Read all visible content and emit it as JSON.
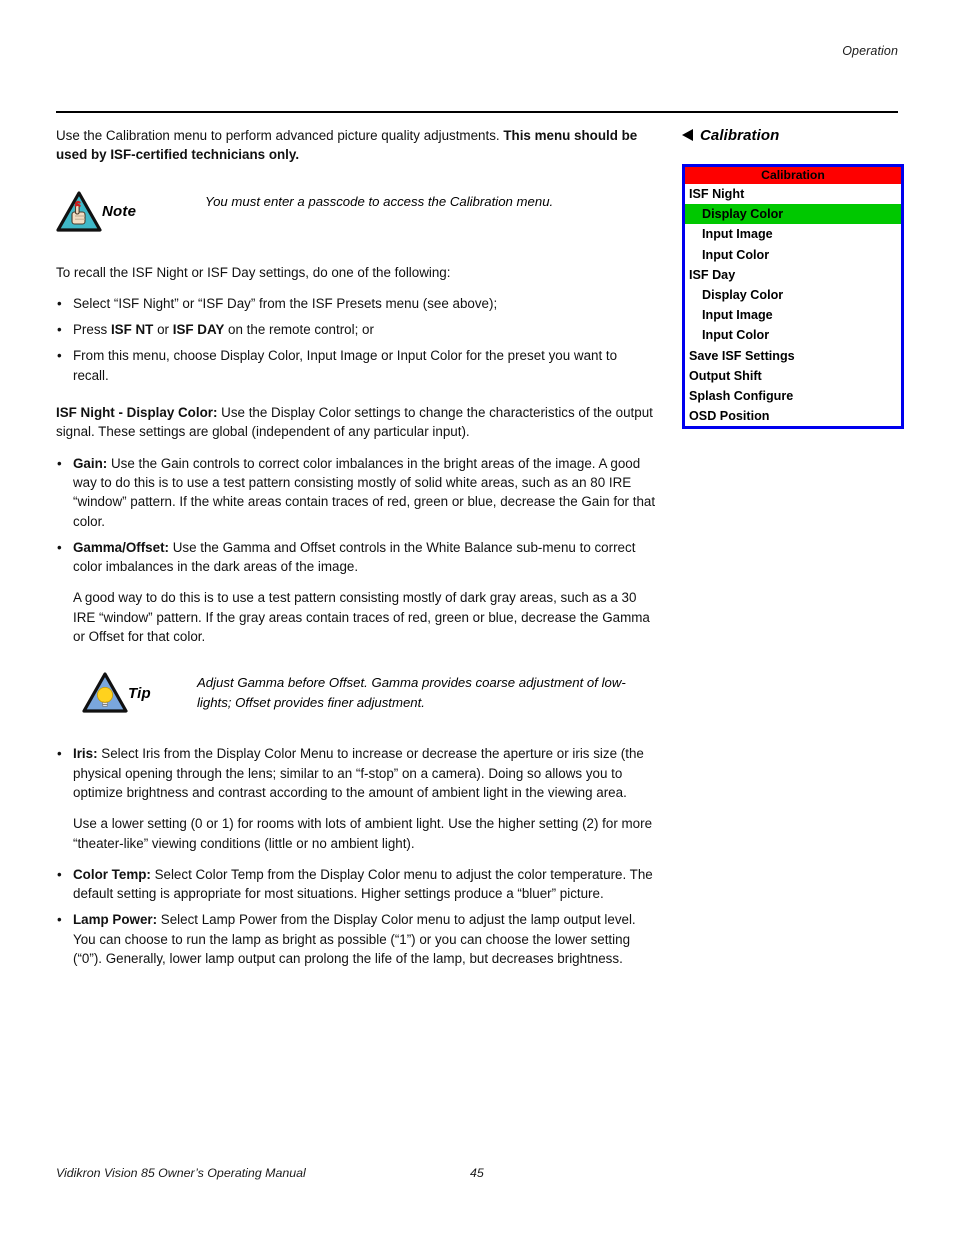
{
  "header": {
    "section_label": "Operation"
  },
  "intro": {
    "text_normal": "Use the Calibration menu to perform advanced picture quality adjustments. ",
    "text_bold": "This menu should be used by ISF-certified technicians only."
  },
  "note_callout": {
    "icon": "note-hand-string-triangle-icon",
    "label": "Note",
    "body": "You must enter a passcode to access the Calibration menu."
  },
  "recall_intro": "To recall the ISF Night or ISF Day settings, do one of the following:",
  "recall_bullets": [
    {
      "bullet": "•",
      "parts": [
        {
          "bold": false,
          "text": "Select “ISF Night” or “ISF Day” from the ISF Presets menu (see above);"
        }
      ]
    },
    {
      "bullet": "•",
      "parts": [
        {
          "bold": false,
          "text": "Press "
        },
        {
          "bold": true,
          "text": "ISF NT"
        },
        {
          "bold": false,
          "text": " or "
        },
        {
          "bold": true,
          "text": "ISF DAY"
        },
        {
          "bold": false,
          "text": " on the remote control; or"
        }
      ]
    },
    {
      "bullet": "•",
      "parts": [
        {
          "bold": false,
          "text": "From this menu, choose Display Color, Input Image or Input Color for the preset you want to recall."
        }
      ]
    }
  ],
  "display_color_para": {
    "lead_bold": "ISF Night - Display Color:",
    "text": " Use the Display Color settings to change the characteristics of the output signal. These settings are global (independent of any particular input)."
  },
  "gain_bullets": [
    {
      "bullet": "•",
      "parts": [
        {
          "bold": true,
          "text": "Gain:"
        },
        {
          "bold": false,
          "text": " Use the Gain controls to correct color imbalances in the bright areas of the image. A good way to do this is to use a test pattern consisting mostly of solid white areas, such as an 80 IRE “window” pattern. If the white areas contain traces of red, green or blue, decrease the Gain for that color."
        }
      ]
    },
    {
      "bullet": "•",
      "parts": [
        {
          "bold": true,
          "text": "Gamma/Offset:"
        },
        {
          "bold": false,
          "text": " Use the Gamma and Offset controls in the White Balance sub-menu to correct color imbalances in the dark areas of the image."
        }
      ]
    }
  ],
  "gamma_subpara": "A good way to do this is to use a test pattern consisting mostly of dark gray areas, such as a 30 IRE “window” pattern. If the gray areas contain traces of red, green or blue, decrease the Gamma or Offset for that color.",
  "tip_callout": {
    "icon": "tip-lightbulb-triangle-icon",
    "label": "Tip",
    "body": "Adjust Gamma before Offset. Gamma provides coarse adjustment of low-lights; Offset provides finer adjustment."
  },
  "iris_bullet": {
    "bullet": "•",
    "parts": [
      {
        "bold": true,
        "text": "Iris:"
      },
      {
        "bold": false,
        "text": " Select Iris from the Display Color Menu to increase or decrease the aperture or iris size (the physical opening through the lens; similar to an “f-stop” on a camera). Doing so allows you to optimize brightness and contrast according to the amount of ambient light in the viewing area."
      }
    ]
  },
  "iris_subpara": "Use a lower setting (0 or 1) for rooms with lots of ambient light. Use the higher setting (2) for more “theater-like” viewing conditions (little or no ambient light).",
  "final_bullets": [
    {
      "bullet": "•",
      "parts": [
        {
          "bold": true,
          "text": "Color Temp:"
        },
        {
          "bold": false,
          "text": " Select Color Temp from the Display Color menu to adjust the color temperature. The default setting is appropriate for most situations. Higher settings produce a “bluer” picture."
        }
      ]
    },
    {
      "bullet": "•",
      "parts": [
        {
          "bold": true,
          "text": "Lamp Power:"
        },
        {
          "bold": false,
          "text": "  Select Lamp Power from the Display Color menu to adjust the lamp output level. You can choose to run the lamp as bright as possible (“1”) or you can choose the lower setting (“0”). Generally, lower lamp output can prolong the life of the lamp, but decreases brightness."
        }
      ]
    }
  ],
  "osd": {
    "heading_icon": "arrow-left-icon",
    "heading": "Calibration",
    "title": "Calibration",
    "colors": {
      "border": "#0000ee",
      "title_bar": "#fe0000",
      "selected_row": "#00c800",
      "background": "#ffffff",
      "text": "#000000"
    },
    "rows": [
      {
        "label": "ISF Night",
        "indent": false,
        "selected": false
      },
      {
        "label": "Display Color",
        "indent": true,
        "selected": true
      },
      {
        "label": "Input Image",
        "indent": true,
        "selected": false
      },
      {
        "label": "Input Color",
        "indent": true,
        "selected": false
      },
      {
        "label": "ISF Day",
        "indent": false,
        "selected": false
      },
      {
        "label": "Display Color",
        "indent": true,
        "selected": false
      },
      {
        "label": "Input Image",
        "indent": true,
        "selected": false
      },
      {
        "label": "Input Color",
        "indent": true,
        "selected": false
      },
      {
        "label": "Save ISF Settings",
        "indent": false,
        "selected": false
      },
      {
        "label": "Output Shift",
        "indent": false,
        "selected": false
      },
      {
        "label": "Splash Configure",
        "indent": false,
        "selected": false
      },
      {
        "label": "OSD Position",
        "indent": false,
        "selected": false
      }
    ]
  },
  "footer": {
    "manual_title": "Vidikron Vision 85 Owner’s Operating Manual",
    "page_number": "45"
  }
}
